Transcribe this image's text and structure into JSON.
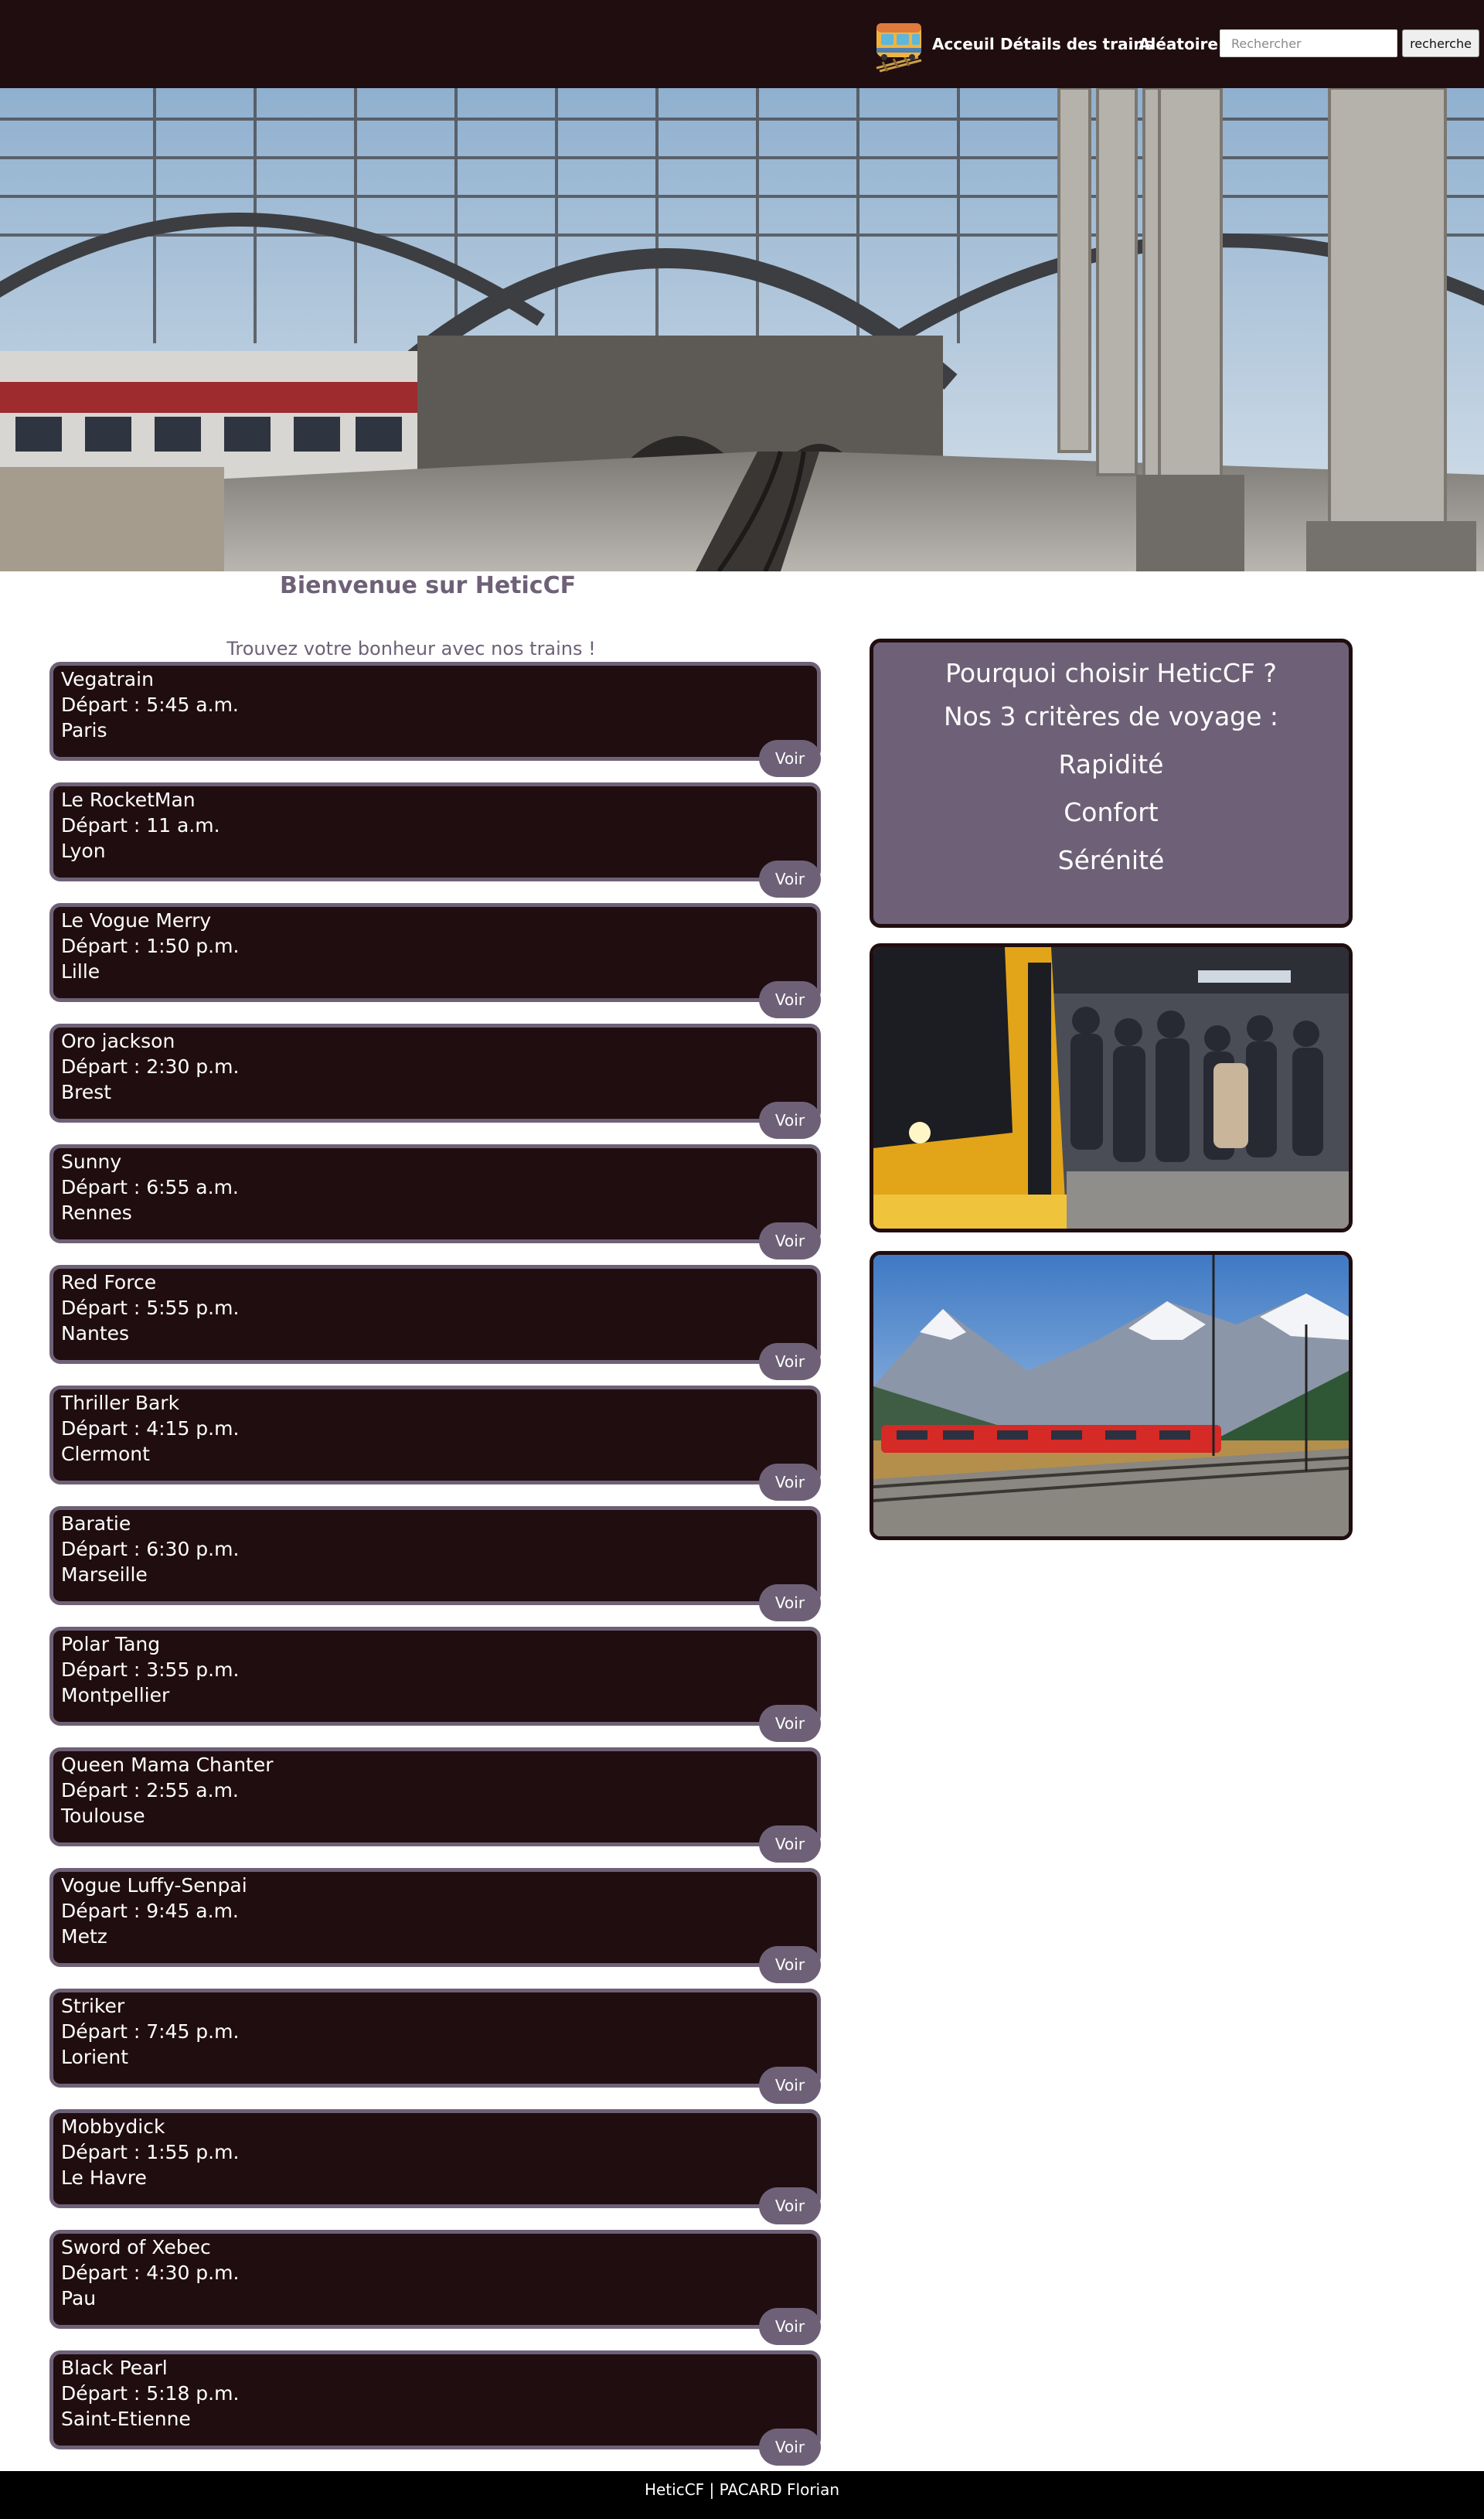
{
  "navbar": {
    "links": {
      "accueil": "Acceuil",
      "details": "Détails des trains",
      "aleatoire": "Aléatoire"
    },
    "search_placeholder": "Rechercher",
    "search_button": "recherche"
  },
  "main": {
    "welcome": "Bienvenue sur HeticCF",
    "tagline": "Trouvez votre bonheur avec nos trains !"
  },
  "trains": [
    {
      "name": "Vegatrain",
      "depart": "Départ : 5:45 a.m.",
      "city": "Paris"
    },
    {
      "name": "Le RocketMan",
      "depart": "Départ : 11 a.m.",
      "city": "Lyon"
    },
    {
      "name": "Le Vogue Merry",
      "depart": "Départ : 1:50 p.m.",
      "city": "Lille"
    },
    {
      "name": "Oro jackson",
      "depart": "Départ : 2:30 p.m.",
      "city": "Brest"
    },
    {
      "name": "Sunny",
      "depart": "Départ : 6:55 a.m.",
      "city": "Rennes"
    },
    {
      "name": "Red Force",
      "depart": "Départ : 5:55 p.m.",
      "city": "Nantes"
    },
    {
      "name": "Thriller Bark",
      "depart": "Départ : 4:15 p.m.",
      "city": "Clermont"
    },
    {
      "name": "Baratie",
      "depart": "Départ : 6:30 p.m.",
      "city": "Marseille"
    },
    {
      "name": "Polar Tang",
      "depart": "Départ : 3:55 p.m.",
      "city": "Montpellier"
    },
    {
      "name": "Queen Mama Chanter",
      "depart": "Départ : 2:55 a.m.",
      "city": "Toulouse"
    },
    {
      "name": "Vogue Luffy-Senpai",
      "depart": "Départ : 9:45 a.m.",
      "city": "Metz"
    },
    {
      "name": "Striker",
      "depart": "Départ : 7:45 p.m.",
      "city": "Lorient"
    },
    {
      "name": "Mobbydick",
      "depart": "Départ : 1:55 p.m.",
      "city": "Le Havre"
    },
    {
      "name": "Sword of Xebec",
      "depart": "Départ : 4:30 p.m.",
      "city": "Pau"
    },
    {
      "name": "Black Pearl",
      "depart": "Départ : 5:18 p.m.",
      "city": "Saint-Etienne"
    }
  ],
  "voir_label": "Voir",
  "why": {
    "title": "Pourquoi choisir HeticCF ?",
    "subtitle": "Nos 3 critères de voyage :",
    "criteria": [
      "Rapidité",
      "Confort",
      "Sérénité"
    ]
  },
  "footer": "HeticCF | PACARD Florian",
  "colors": {
    "dark": "#200d10",
    "accent": "#6e6177",
    "footer": "#000000"
  },
  "icons": {
    "logo": "train-logo-icon"
  }
}
